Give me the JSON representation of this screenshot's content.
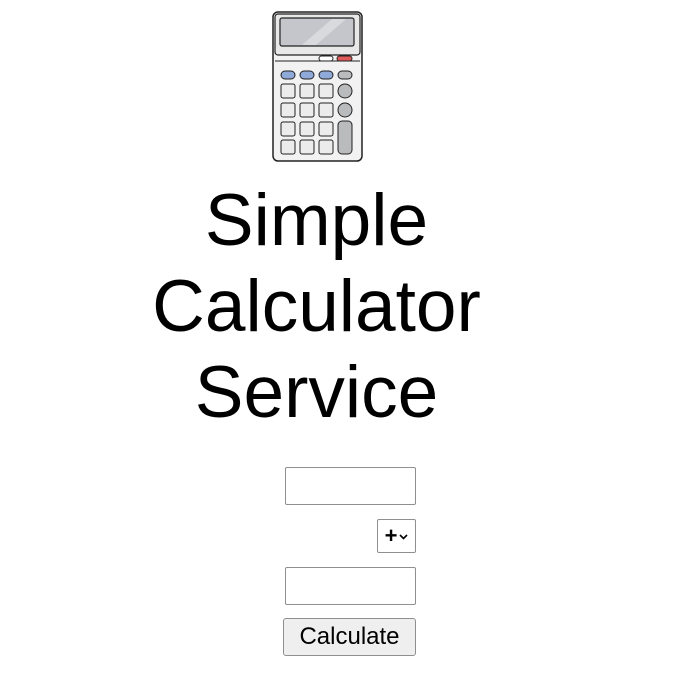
{
  "page": {
    "title_lines": [
      "Simple",
      "Calculator",
      "Service"
    ],
    "logo_icon": "calculator-icon"
  },
  "form": {
    "first_number": {
      "value": "",
      "placeholder": ""
    },
    "operator": {
      "selected": "+",
      "icon": "chevron-down-icon"
    },
    "second_number": {
      "value": "",
      "placeholder": ""
    },
    "submit_label": "Calculate"
  },
  "colors": {
    "display": "#c4c6cb",
    "blue_keys": "#8fa9d8",
    "red_key": "#e05a5a",
    "gray_keys": "#b9bbbd",
    "key_face": "#ececec"
  }
}
